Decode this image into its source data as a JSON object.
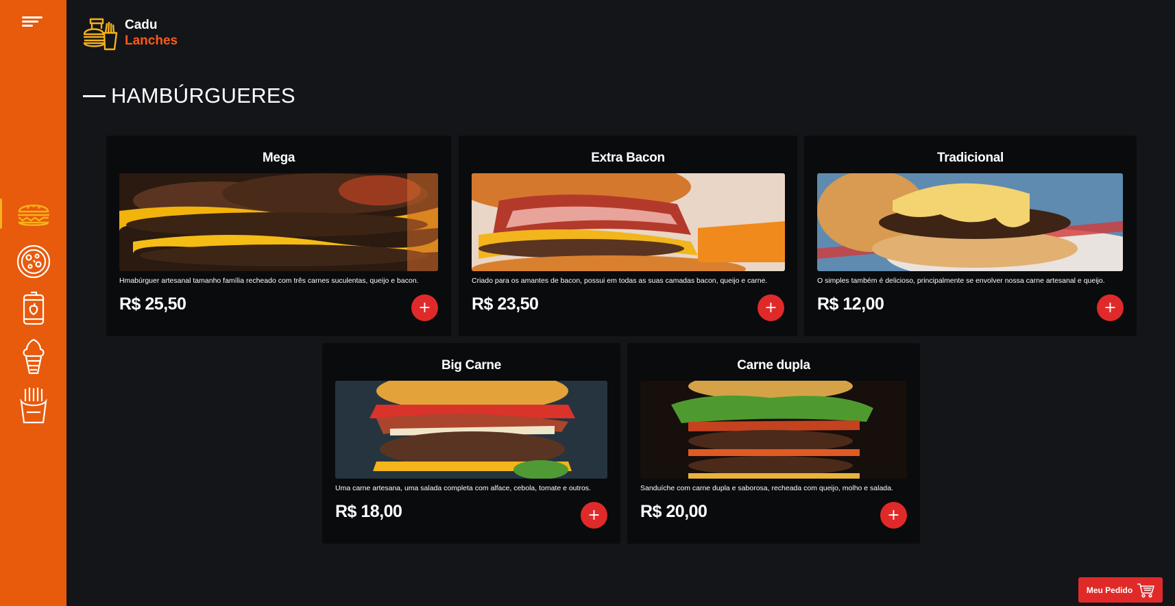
{
  "brand": {
    "name_line1": "Cadu",
    "name_line2": "Lanches",
    "logo_icon": "burger-fries-logo-icon"
  },
  "sidebar": {
    "menu_icon": "menu-icon",
    "items": [
      {
        "name": "burgers",
        "icon": "burger-icon",
        "active": true
      },
      {
        "name": "pizzas",
        "icon": "pizza-icon",
        "active": false
      },
      {
        "name": "drinks",
        "icon": "soda-can-icon",
        "active": false
      },
      {
        "name": "desserts",
        "icon": "ice-cream-icon",
        "active": false
      },
      {
        "name": "sides",
        "icon": "fries-icon",
        "active": false
      }
    ]
  },
  "section": {
    "title": "HAMBÚRGUERES"
  },
  "products": [
    {
      "title": "Mega",
      "description": "Hmabúrguer artesanal tamanho família recheado com três carnes suculentas, queijo e bacon.",
      "price": "R$ 25,50",
      "add_label": "+"
    },
    {
      "title": "Extra Bacon",
      "description": "Criado para os amantes de bacon, possui em todas as suas camadas bacon, queijo e carne.",
      "price": "R$ 23,50",
      "add_label": "+"
    },
    {
      "title": "Tradicional",
      "description": "O simples também é delicioso, principalmente se envolver nossa carne artesanal e queijo.",
      "price": "R$ 12,00",
      "add_label": "+"
    },
    {
      "title": "Big Carne",
      "description": "Uma carne artesana, uma salada completa com alface, cebola, tomate e outros.",
      "price": "R$ 18,00",
      "add_label": "+"
    },
    {
      "title": "Carne dupla",
      "description": "Sanduíche com carne dupla e saborosa, recheada com queijo, molho e salada.",
      "price": "R$ 20,00",
      "add_label": "+"
    }
  ],
  "order_button": {
    "label": "Meu Pedido",
    "icon": "cart-icon"
  },
  "colors": {
    "sidebar": "#e85a0c",
    "accent": "#e02a2a",
    "highlight": "#f6b21a",
    "background": "#131519",
    "card": "#0a0b0d"
  }
}
